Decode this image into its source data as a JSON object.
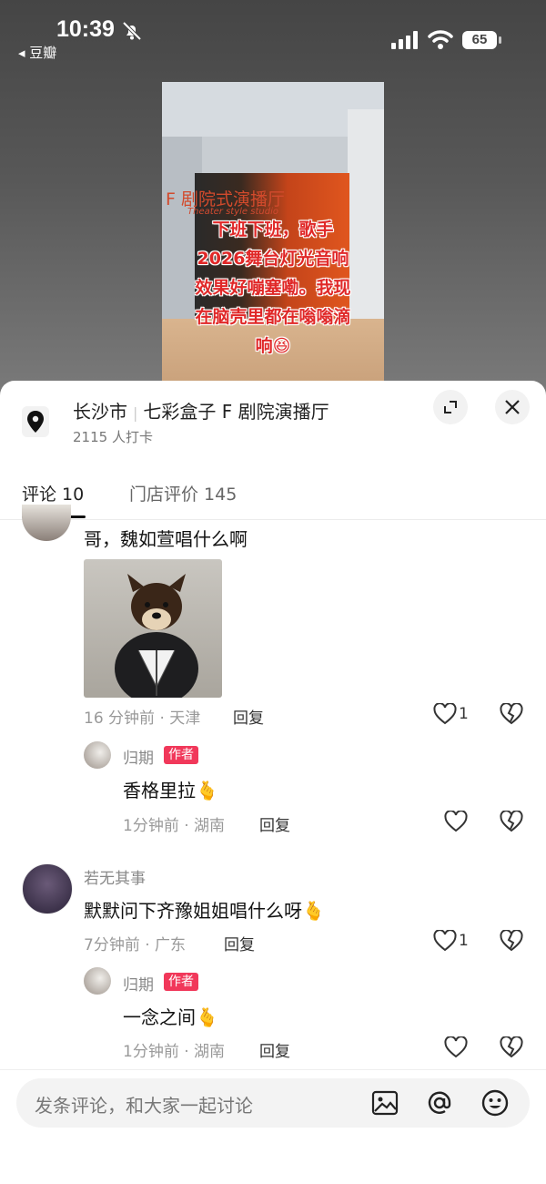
{
  "status_bar": {
    "time": "10:39",
    "back_label": "◂ 豆瓣",
    "battery": "65"
  },
  "video": {
    "sign": "F 剧院式演播厅",
    "sign_sub": "Theater style studio",
    "caption": "下班下班，歌手\n2026舞台灯光音响\n效果好嘣塞嘞。我现\n在脑壳里都在嗡嗡滴\n响😆"
  },
  "location": {
    "city": "长沙市",
    "name": "七彩盒子 F 剧院演播厅",
    "checkins": "2115 人打卡"
  },
  "tabs": {
    "comments": "评论 10",
    "reviews": "门店评价 145"
  },
  "comments": [
    {
      "text": "哥，魏如萱唱什么啊",
      "meta": "16 分钟前 · 天津",
      "reply": "回复",
      "likes": "1",
      "replies": [
        {
          "name": "归期",
          "badge": "作者",
          "text": "香格里拉",
          "emoji": "🫰",
          "meta": "1分钟前 · 湖南",
          "reply": "回复"
        }
      ]
    },
    {
      "name": "若无其事",
      "text": "默默问下齐豫姐姐唱什么呀",
      "emoji": "🫰",
      "meta": "7分钟前 · 广东",
      "reply": "回复",
      "likes": "1",
      "replies": [
        {
          "name": "归期",
          "badge": "作者",
          "text": "一念之间",
          "emoji": "🫰",
          "meta": "1分钟前 · 湖南",
          "reply": "回复"
        }
      ]
    }
  ],
  "input": {
    "placeholder": "发条评论，和大家一起讨论"
  },
  "icons": [
    "bell-muted-icon",
    "signal-icon",
    "wifi-icon",
    "battery-icon",
    "location-pin-icon",
    "expand-icon",
    "close-icon",
    "heart-icon",
    "broken-heart-icon",
    "image-icon",
    "at-icon",
    "emoji-icon"
  ]
}
